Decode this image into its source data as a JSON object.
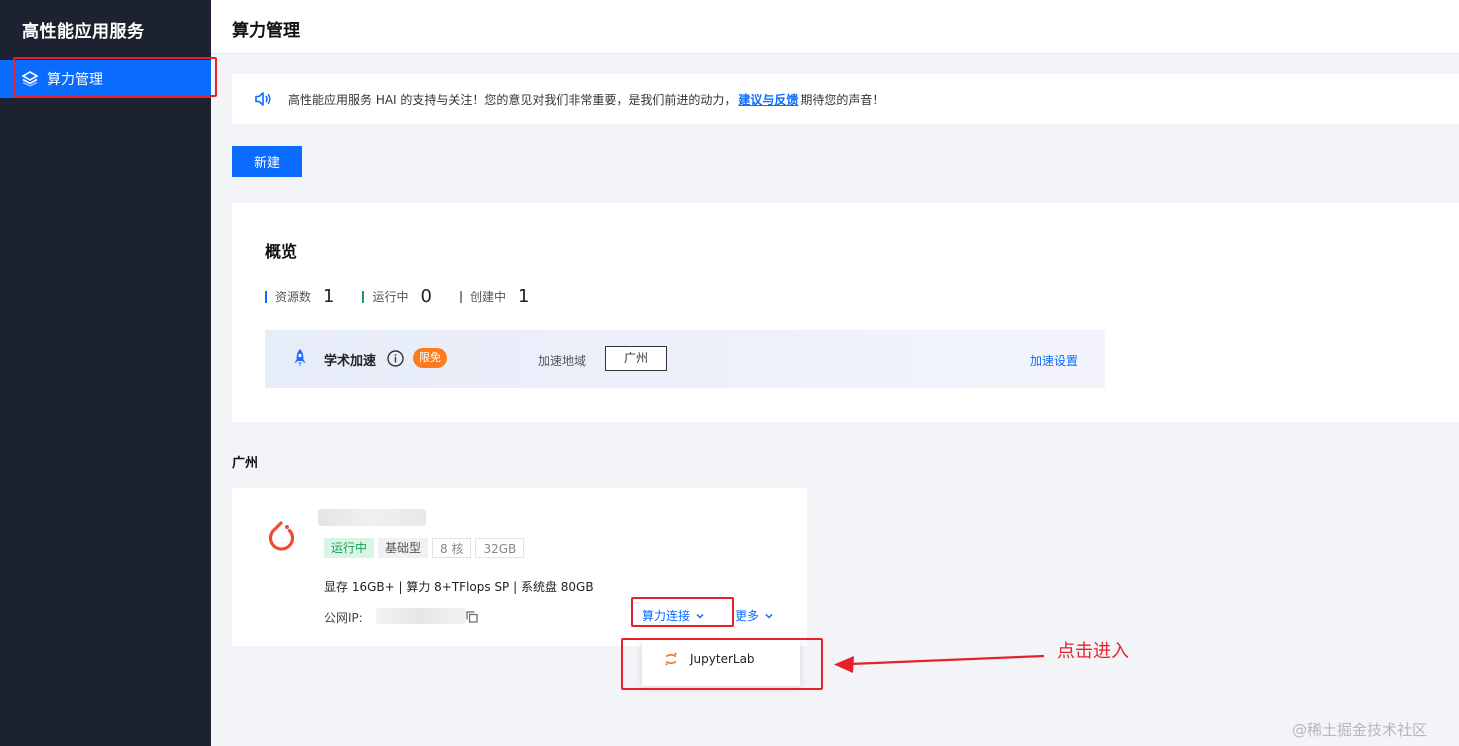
{
  "sidebar": {
    "title": "高性能应用服务",
    "items": [
      {
        "label": "算力管理",
        "icon": "layers-icon"
      }
    ]
  },
  "header": {
    "title": "算力管理"
  },
  "notice": {
    "text_before": "高性能应用服务 HAI 的支持与关注！您的意见对我们非常重要，是我们前进的动力，",
    "link": "建议与反馈",
    "text_after": "期待您的声音！",
    "icon": "speaker-icon"
  },
  "actions": {
    "new_button": "新建"
  },
  "overview": {
    "title": "概览",
    "stats": [
      {
        "label": "资源数",
        "value": "1",
        "color": "#0a6cff"
      },
      {
        "label": "运行中",
        "value": "0",
        "color": "#1b9e5c"
      },
      {
        "label": "创建中",
        "value": "1",
        "color": "#888888"
      }
    ],
    "acceleration": {
      "title": "学术加速",
      "badge": "限免",
      "region_label": "加速地域",
      "region_value": "广州",
      "settings_link": "加速设置"
    }
  },
  "region": {
    "name": "广州"
  },
  "instance": {
    "tags": [
      "运行中",
      "基础型",
      "8 核",
      "32GB"
    ],
    "specs": "显存 16GB+ | 算力 8+TFlops SP | 系统盘 80GB",
    "ip_label": "公网IP:",
    "connect_label": "算力连接",
    "more_label": "更多"
  },
  "dropdown": {
    "items": [
      {
        "label": "JupyterLab"
      }
    ]
  },
  "annotation": {
    "text": "点击进入"
  },
  "watermark": "@稀土掘金技术社区",
  "colors": {
    "primary": "#0a6cff",
    "sidebar_bg": "#1c2230",
    "annotation_red": "#e6212a",
    "free_badge": "#ff7a1a"
  }
}
